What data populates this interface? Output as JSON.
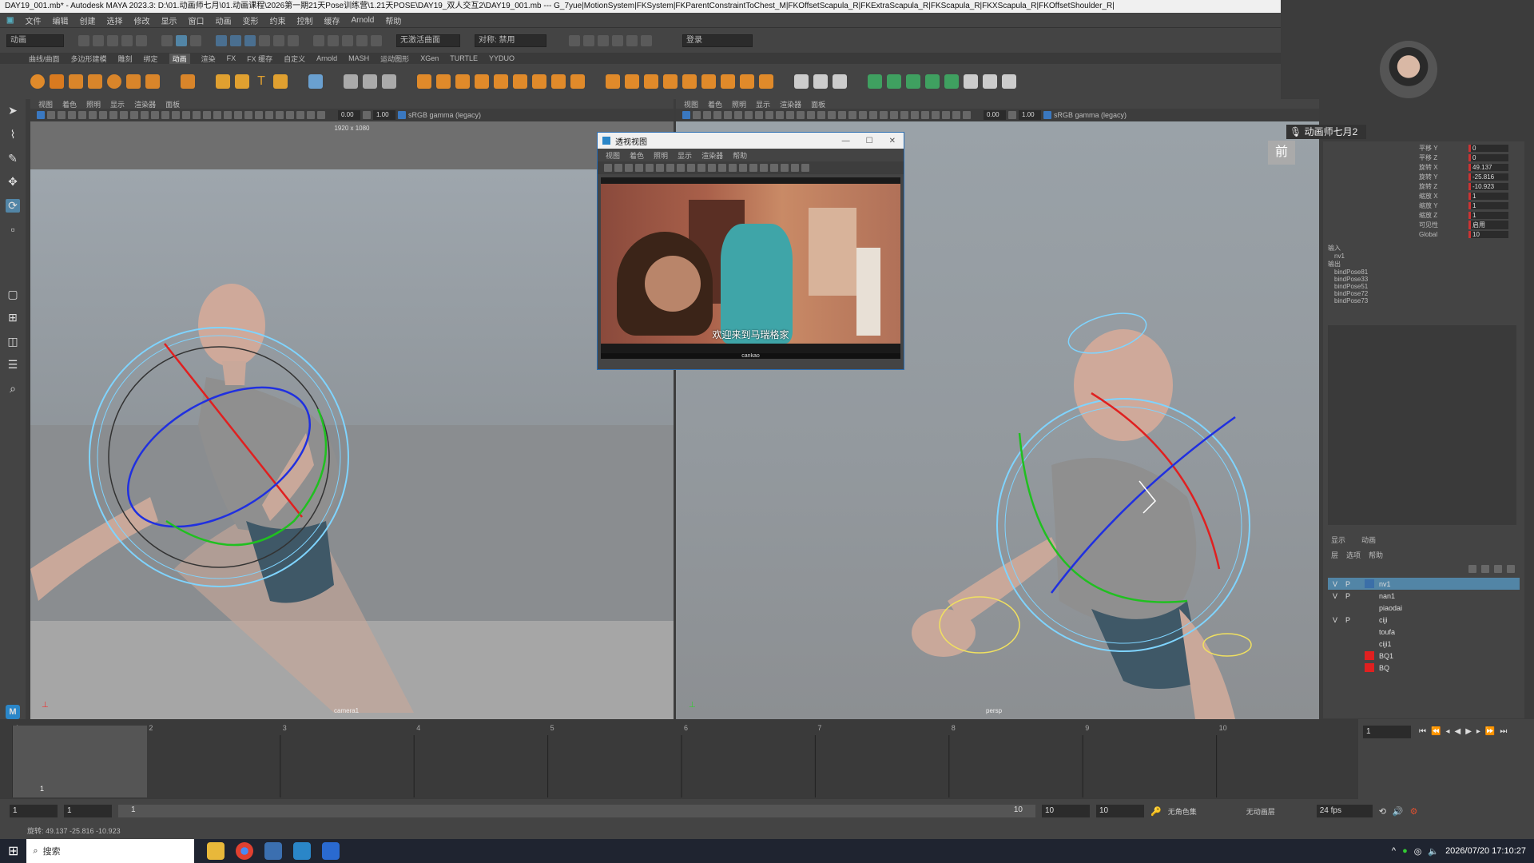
{
  "window": {
    "title": "DAY19_001.mb* - Autodesk MAYA 2023.3: D:\\01.动画师七月\\01.动画课程\\2026第一期21天Pose训练营\\1.21天POSE\\DAY19_双人交互2\\DAY19_001.mb  ---  G_7yue|MotionSystem|FKSystem|FKParentConstraintToChest_M|FKOffsetScapula_R|FKExtraScapula_R|FKScapula_R|FKXScapula_R|FKOffsetShoulder_R|"
  },
  "menubar": [
    "文件",
    "编辑",
    "创建",
    "选择",
    "修改",
    "显示",
    "窗口",
    "动画",
    "变形",
    "约束",
    "控制",
    "缓存",
    "Arnold",
    "帮助"
  ],
  "statusline": {
    "mode": "动画",
    "live_surface": "无激活曲面",
    "symmetry": "对称: 禁用",
    "login": "登录"
  },
  "shelf_tabs": [
    "曲线/曲面",
    "多边形建模",
    "雕刻",
    "绑定",
    "动画",
    "渲染",
    "FX",
    "FX 缓存",
    "自定义",
    "Arnold",
    "MASH",
    "运动图形",
    "XGen",
    "TURTLE",
    "YYDUO"
  ],
  "active_shelf_tab": "动画",
  "panel_menu": [
    "视图",
    "着色",
    "照明",
    "显示",
    "渲染器",
    "面板"
  ],
  "viewport_left": {
    "resolution": "1920 x 1080",
    "camera": "camera1",
    "exposure": "0.00",
    "gamma": "1.00",
    "colorspace": "sRGB gamma (legacy)"
  },
  "viewport_right": {
    "camera": "persp",
    "view_button": "前",
    "exposure": "0.00",
    "gamma": "1.00",
    "colorspace": "sRGB gamma (legacy)"
  },
  "float_window": {
    "title": "透视视图",
    "menu": [
      "视图",
      "着色",
      "照明",
      "显示",
      "渲染器",
      "帮助"
    ],
    "subtitle": "欢迎来到马瑞格家",
    "caption": "cankao"
  },
  "webcam": {
    "name": "动画师七月2"
  },
  "channel_box": {
    "channels": [
      {
        "label": "平移 Y",
        "value": "0"
      },
      {
        "label": "平移 Z",
        "value": "0"
      },
      {
        "label": "旋转 X",
        "value": "49.137"
      },
      {
        "label": "旋转 Y",
        "value": "-25.816"
      },
      {
        "label": "旋转 Z",
        "value": "-10.923"
      },
      {
        "label": "缩放 X",
        "value": "1"
      },
      {
        "label": "缩放 Y",
        "value": "1"
      },
      {
        "label": "缩放 Z",
        "value": "1"
      },
      {
        "label": "可见性",
        "value": "启用"
      },
      {
        "label": "Global",
        "value": "10"
      }
    ],
    "inputs_label": "输入",
    "inputs": [
      "nv1"
    ],
    "outputs_label": "输出",
    "outputs": [
      "bindPose81",
      "bindPose33",
      "bindPose51",
      "bindPose72",
      "bindPose73"
    ]
  },
  "layer_editor": {
    "tabs": [
      "显示",
      "动画"
    ],
    "menu": [
      "层",
      "选项",
      "帮助"
    ],
    "layers": [
      {
        "v": "V",
        "p": "P",
        "name": "nv1",
        "color": "#3b6fa8",
        "selected": true
      },
      {
        "v": "V",
        "p": "P",
        "name": "nan1",
        "color": "",
        "selected": false
      },
      {
        "v": "",
        "p": "",
        "name": "piaodai",
        "color": "",
        "selected": false
      },
      {
        "v": "V",
        "p": "P",
        "name": "ciji",
        "color": "",
        "selected": false
      },
      {
        "v": "",
        "p": "",
        "name": "toufa",
        "color": "",
        "selected": false
      },
      {
        "v": "",
        "p": "",
        "name": "ciji1",
        "color": "",
        "selected": false
      },
      {
        "v": "",
        "p": "",
        "name": "BQ1",
        "color": "#e02020",
        "selected": false
      },
      {
        "v": "",
        "p": "",
        "name": "BQ",
        "color": "#e02020",
        "selected": false
      }
    ]
  },
  "timeline": {
    "ticks": [
      "1",
      "2",
      "3",
      "4",
      "5",
      "6",
      "7",
      "8",
      "9",
      "10"
    ],
    "current_frame": "1",
    "current_frame_field": "1"
  },
  "range_slider": {
    "start": "1",
    "anim_start": "1",
    "range_start": "1",
    "range_end": "10",
    "anim_end": "10",
    "end": "10",
    "character_set": "无角色集",
    "anim_layer": "无动画层",
    "fps": "24 fps"
  },
  "help_line": "旋转: 49.137 -25.816 -10.923",
  "taskbar": {
    "search": "搜索",
    "datetime": "2026/07/20 17:10:27"
  },
  "colors": {
    "accent": "#5285a6",
    "rotate_x": "#e02020",
    "rotate_y": "#20c020",
    "rotate_z": "#2030e0",
    "rotate_ring": "#7fd4ff"
  }
}
